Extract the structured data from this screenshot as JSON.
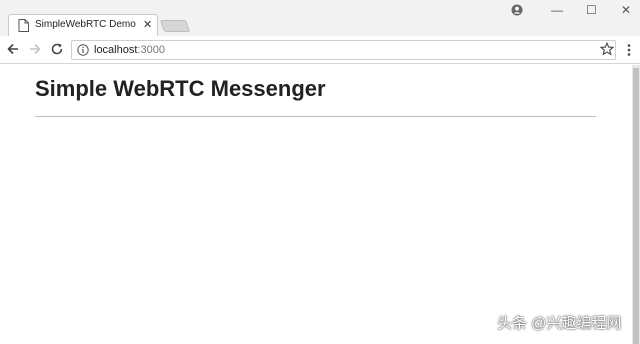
{
  "browser": {
    "tab": {
      "title": "SimpleWebRTC Demo",
      "close_glyph": "✕",
      "icon": "page-icon"
    },
    "window_controls": {
      "minimize": "—",
      "maximize": "☐",
      "close": "✕"
    },
    "toolbar": {
      "url_host": "localhost",
      "url_port": ":3000",
      "icons": [
        "back-arrow-icon",
        "forward-arrow-icon",
        "reload-icon",
        "info-icon",
        "star-icon",
        "menu-dots-icon",
        "profile-icon"
      ]
    }
  },
  "page": {
    "heading": "Simple WebRTC Messenger"
  },
  "watermark": {
    "text": "头条 @兴趣编程网"
  },
  "colors": {
    "tabstrip_bg": "#f2f2f2",
    "text": "#222222",
    "rule": "#bdbdbd"
  }
}
